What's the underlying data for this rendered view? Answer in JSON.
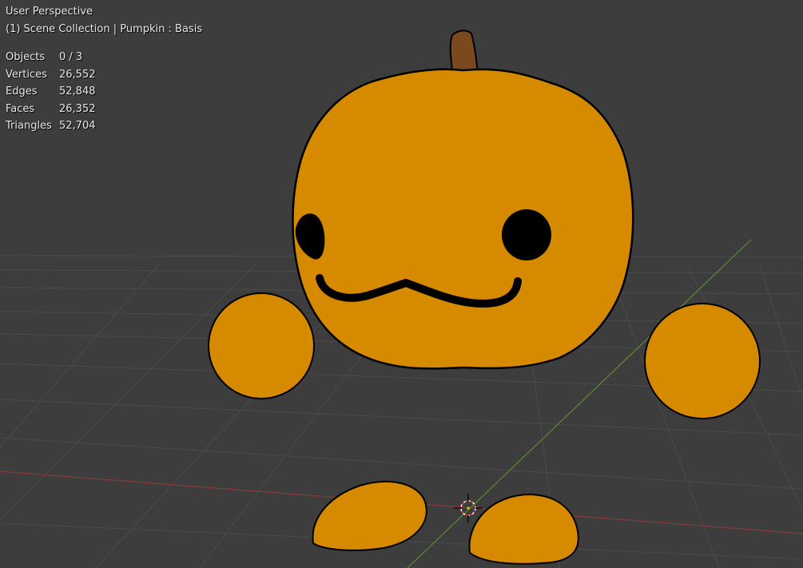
{
  "viewport": {
    "view_name": "User Perspective",
    "collection_info": "(1) Scene Collection | Pumpkin : Basis",
    "stats": [
      {
        "label": "Objects",
        "value": "0 / 3"
      },
      {
        "label": "Vertices",
        "value": "26,552"
      },
      {
        "label": "Edges",
        "value": "52,848"
      },
      {
        "label": "Faces",
        "value": "26,352"
      },
      {
        "label": "Triangles",
        "value": "52,704"
      }
    ]
  },
  "colors": {
    "background": "#3d3d3d",
    "grid_line": "#4a4a4a",
    "x_axis": "#8a3a3a",
    "y_axis": "#5f8a2e",
    "pumpkin_body": "#d68a00",
    "outline": "#000000",
    "stem": "#7a4a1e"
  },
  "objects": [
    {
      "name": "pumpkin-head",
      "icon": "pumpkin"
    },
    {
      "name": "left-hand",
      "icon": "sphere"
    },
    {
      "name": "right-hand",
      "icon": "sphere"
    },
    {
      "name": "left-foot",
      "icon": "half-sphere"
    },
    {
      "name": "right-foot",
      "icon": "half-sphere"
    }
  ]
}
